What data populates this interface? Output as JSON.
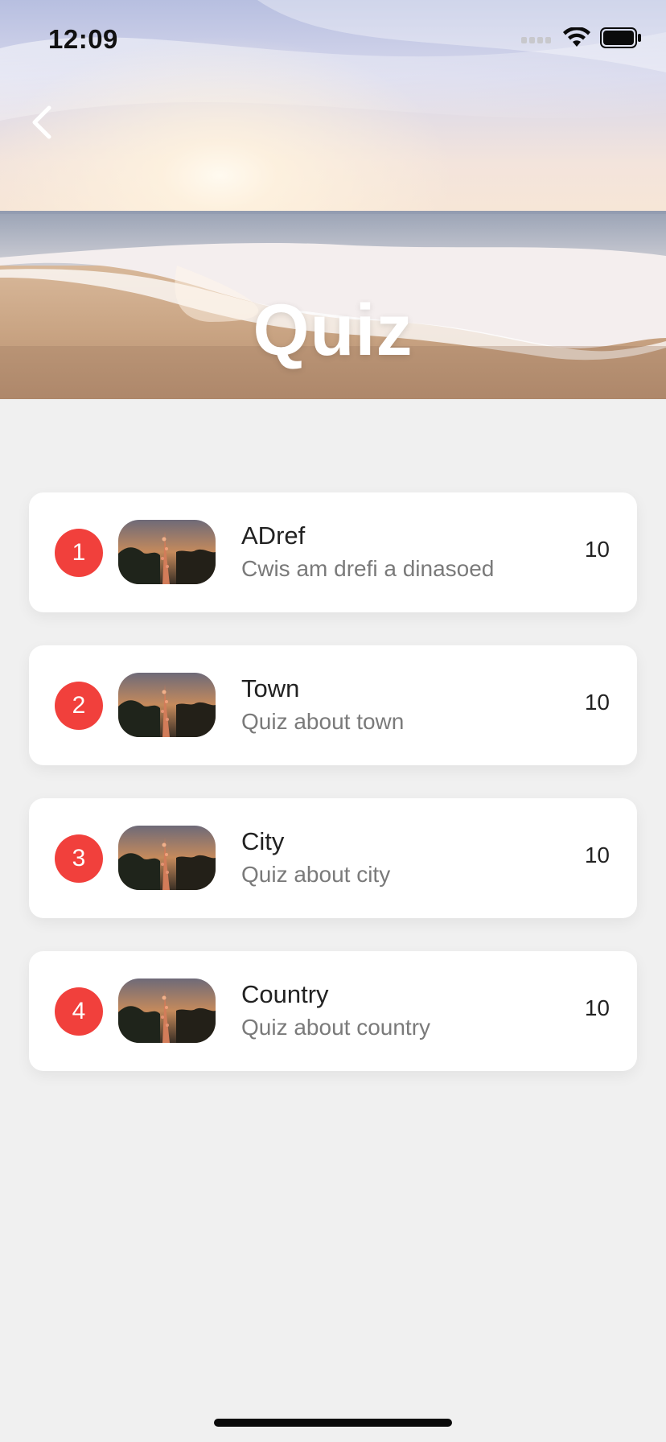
{
  "status_bar": {
    "time": "12:09",
    "icons": [
      "cellular-signal-icon",
      "wifi-icon",
      "battery-icon"
    ]
  },
  "header": {
    "title": "Quiz",
    "back_icon": "chevron-left-icon"
  },
  "colors": {
    "badge": "#f1403c",
    "background": "#f0f0f0",
    "card": "#ffffff"
  },
  "quizzes": [
    {
      "rank": "1",
      "title": "ADref",
      "subtitle": "Cwis am drefi a dinasoed",
      "count": "10"
    },
    {
      "rank": "2",
      "title": "Town",
      "subtitle": "Quiz about town",
      "count": "10"
    },
    {
      "rank": "3",
      "title": "City",
      "subtitle": "Quiz about city",
      "count": "10"
    },
    {
      "rank": "4",
      "title": "Country",
      "subtitle": "Quiz about country",
      "count": "10"
    }
  ]
}
